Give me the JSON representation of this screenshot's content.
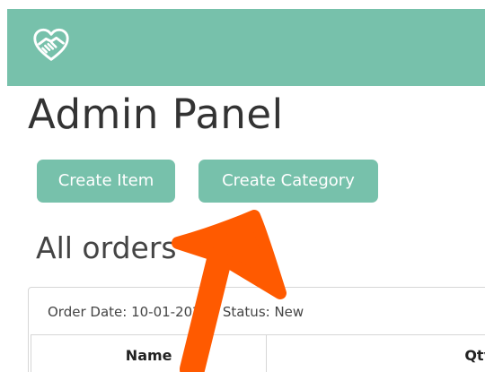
{
  "brand": {
    "icon": "heart-handshake-icon"
  },
  "page": {
    "title": "Admin Panel"
  },
  "actions": {
    "create_item_label": "Create Item",
    "create_category_label": "Create Category"
  },
  "orders": {
    "section_title": "All orders",
    "first_order": {
      "meta": "Order Date: 10-01-2024 | Status: New"
    },
    "table_headers": [
      "Name",
      "Qty"
    ]
  },
  "annotation": {
    "arrow_color": "#ff5a00",
    "target": "create-category-button"
  },
  "colors": {
    "accent": "#77c1ab"
  }
}
